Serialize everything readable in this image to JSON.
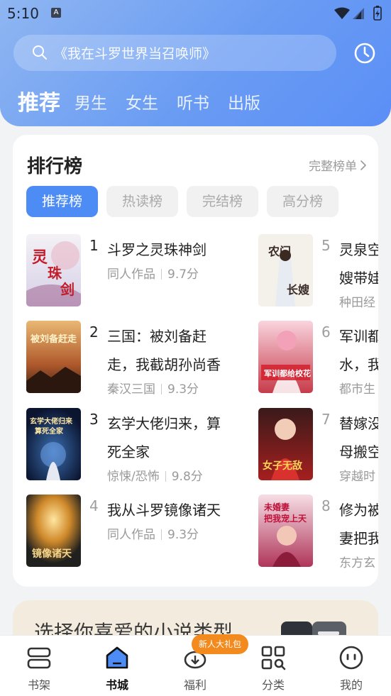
{
  "status_bar": {
    "time": "5:10",
    "notification_letter": "A"
  },
  "header": {
    "search_placeholder": "《我在斗罗世界当召唤师》",
    "tabs": [
      {
        "label": "推荐",
        "active": true
      },
      {
        "label": "男生",
        "active": false
      },
      {
        "label": "女生",
        "active": false
      },
      {
        "label": "听书",
        "active": false
      },
      {
        "label": "出版",
        "active": false
      }
    ]
  },
  "ranking": {
    "title": "排行榜",
    "more_label": "完整榜单",
    "tabs": [
      {
        "label": "推荐榜",
        "active": true
      },
      {
        "label": "热读榜",
        "active": false
      },
      {
        "label": "完结榜",
        "active": false
      },
      {
        "label": "高分榜",
        "active": false
      }
    ],
    "books": [
      {
        "rank": "1",
        "title": "斗罗之灵珠神剑",
        "genre": "同人作品",
        "score": "9.7分",
        "cover_text": "灵珠神剑"
      },
      {
        "rank": "2",
        "title": "三国：被刘备赶走，我截胡孙尚香",
        "genre": "秦汉三国",
        "score": "9.3分",
        "cover_text": "被刘备赶走"
      },
      {
        "rank": "3",
        "title": "玄学大佬归来，算死全家",
        "genre": "惊悚/恐怖",
        "score": "9.8分",
        "cover_text": "玄学大佬归来算死全家"
      },
      {
        "rank": "4",
        "title": "我从斗罗镜像诸天",
        "genre": "同人作品",
        "score": "9.3分",
        "cover_text": "镜像诸天"
      },
      {
        "rank": "5",
        "title": "灵泉空间：农门长嫂带娃种田",
        "genre": "种田经商",
        "score": "",
        "cover_text": "农门长嫂"
      },
      {
        "rank": "6",
        "title": "军训都给校花送水，我",
        "genre": "都市生活",
        "score": "",
        "cover_text": "军训都给校花送水"
      },
      {
        "rank": "7",
        "title": "替嫁没关系，母搬空",
        "genre": "穿越时空",
        "score": "",
        "cover_text": "女子无敌"
      },
      {
        "rank": "8",
        "title": "修为被废，妻把我",
        "genre": "东方玄幻",
        "score": "",
        "cover_text": "未婚妻把我宠上天"
      }
    ],
    "visible": {
      "b5_line1": "灵泉空",
      "b5_line2": "嫂带娃",
      "b5_meta": "种田经",
      "b6_line1": "军训都",
      "b6_line2": "水，我",
      "b6_meta": "都市生",
      "b7_line1": "替嫁没",
      "b7_line2": "母搬空",
      "b7_meta": "穿越时",
      "b8_line1": "修为被",
      "b8_line2": "妻把我",
      "b8_meta": "东方玄"
    }
  },
  "genre_banner": {
    "text": "选择你喜爱的小说类型"
  },
  "bottom_nav": {
    "items": [
      {
        "label": "书架",
        "icon": "bookshelf-icon",
        "active": false
      },
      {
        "label": "书城",
        "icon": "bookstore-icon",
        "active": true
      },
      {
        "label": "福利",
        "icon": "gift-icon",
        "active": false
      },
      {
        "label": "分类",
        "icon": "category-icon",
        "active": false
      },
      {
        "label": "我的",
        "icon": "profile-icon",
        "active": false
      }
    ],
    "badge": "新人大礼包"
  },
  "colors": {
    "accent": "#4d8cf5",
    "badge": "#f28a1d",
    "header_start": "#8fb6f2",
    "header_end": "#5b8ff6"
  }
}
